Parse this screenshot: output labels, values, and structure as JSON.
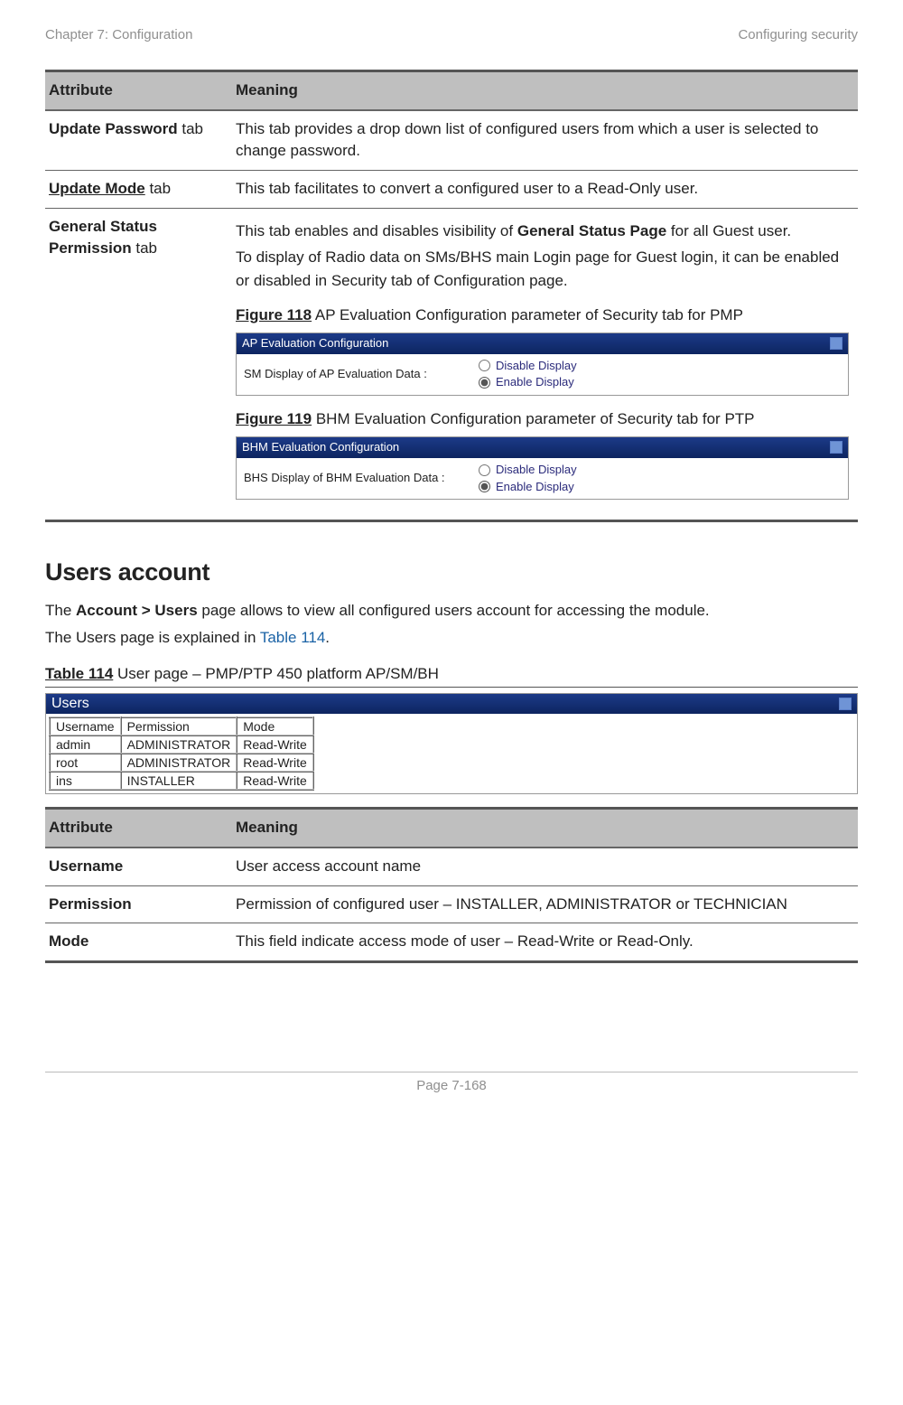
{
  "header": {
    "left": "Chapter 7:  Configuration",
    "right": "Configuring security"
  },
  "table1": {
    "col_a": "Attribute",
    "col_b": "Meaning",
    "rows": [
      {
        "attr_bold": "Update Password",
        "attr_rest": " tab",
        "meaning_a": "This tab provides a drop down list of configured users from which a user is selected to change password."
      },
      {
        "attr_underline_bold": "Update Mode",
        "attr_rest": " tab",
        "meaning_a": "This tab facilitates to convert a configured user to a Read-Only user."
      },
      {
        "attr_bold": "General Status Permission",
        "attr_rest": " tab",
        "meaning_p1_pre": "This tab enables and disables visibility of ",
        "meaning_p1_bold": "General Status Page",
        "meaning_p1_post": " for all Guest user.",
        "meaning_p2": "To display of Radio data on SMs/BHS main Login page for Guest login, it can be enabled or disabled in Security tab of Configuration page.",
        "fig118_label_b": "Figure 118",
        "fig118_label_r": " AP Evaluation Configuration parameter of Security tab for PMP",
        "fig119_label_b": "Figure 119",
        "fig119_label_r": " BHM Evaluation Configuration parameter of Security tab for PTP"
      }
    ]
  },
  "widget_ap": {
    "title": "AP Evaluation Configuration",
    "label": "SM Display of AP Evaluation Data :",
    "opt1": "Disable Display",
    "opt2": "Enable Display"
  },
  "widget_bhm": {
    "title": "BHM Evaluation Configuration",
    "label": "BHS Display of BHM Evaluation Data :",
    "opt1": "Disable Display",
    "opt2": "Enable Display"
  },
  "section": {
    "heading": "Users account",
    "p1_pre": "The ",
    "p1_bold": "Account > Users",
    "p1_post": " page allows to view all configured users account for accessing the module.",
    "p2_pre": "The Users page is explained in ",
    "p2_link": "Table 114",
    "p2_post": "."
  },
  "table114_caption_b": "Table 114",
  "table114_caption_r": " User page – PMP/PTP 450 platform AP/SM/BH",
  "users_widget": {
    "title": "Users",
    "cols": [
      "Username",
      "Permission",
      "Mode"
    ],
    "rows": [
      [
        "admin",
        "ADMINISTRATOR",
        "Read-Write"
      ],
      [
        "root",
        "ADMINISTRATOR",
        "Read-Write"
      ],
      [
        "ins",
        "INSTALLER",
        "Read-Write"
      ]
    ]
  },
  "table2": {
    "col_a": "Attribute",
    "col_b": "Meaning",
    "rows": [
      {
        "attr": "Username",
        "meaning": "User access account name"
      },
      {
        "attr": "Permission",
        "meaning": "Permission of configured user – INSTALLER, ADMINISTRATOR or TECHNICIAN"
      },
      {
        "attr": "Mode",
        "meaning": "This field indicate access mode of user – Read-Write or Read-Only."
      }
    ]
  },
  "footer": "Page 7-168"
}
